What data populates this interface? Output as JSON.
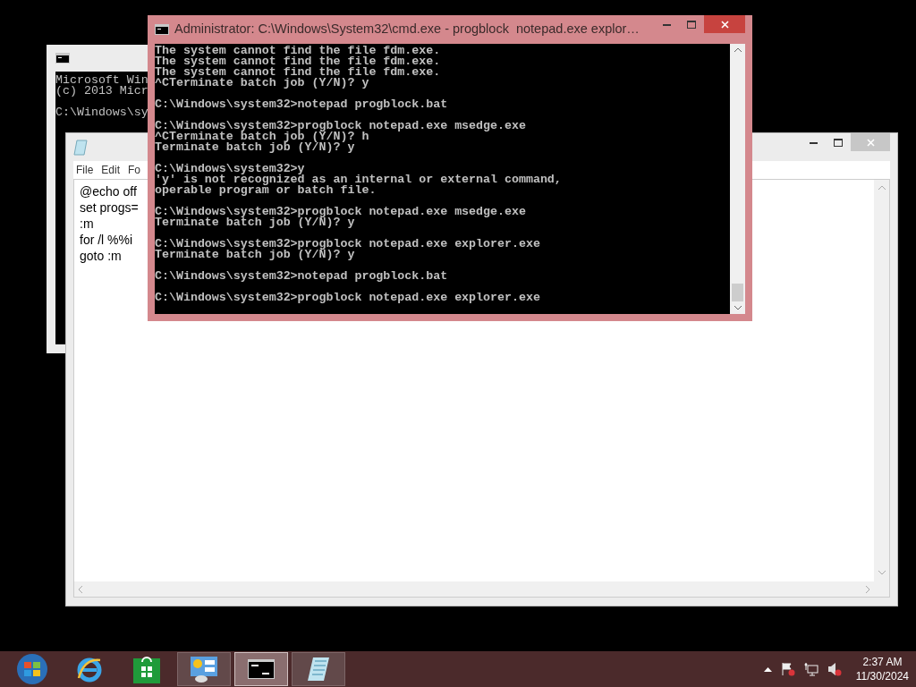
{
  "back_console": {
    "groups": [
      [
        "Microsoft Win",
        "(c) 2013 Micr"
      ],
      [
        "C:\\Windows\\sy"
      ]
    ]
  },
  "notepad": {
    "menu": [
      {
        "label": "File"
      },
      {
        "label": "Edit"
      },
      {
        "label": "Fo"
      }
    ],
    "lines": [
      "@echo off",
      "set progs=",
      ":m",
      "for /l %%i",
      "goto :m"
    ]
  },
  "console": {
    "title": "Administrator: C:\\Windows\\System32\\cmd.exe - progblock  notepad.exe explor…",
    "groups": [
      [
        "The system cannot find the file fdm.exe.",
        "The system cannot find the file fdm.exe.",
        "The system cannot find the file fdm.exe.",
        "^CTerminate batch job (Y/N)? y"
      ],
      [
        "C:\\Windows\\system32>notepad progblock.bat"
      ],
      [
        "C:\\Windows\\system32>progblock notepad.exe msedge.exe",
        "^CTerminate batch job (Y/N)? h",
        "Terminate batch job (Y/N)? y"
      ],
      [
        "C:\\Windows\\system32>y",
        "'y' is not recognized as an internal or external command,",
        "operable program or batch file."
      ],
      [
        "C:\\Windows\\system32>progblock notepad.exe msedge.exe",
        "Terminate batch job (Y/N)? y"
      ],
      [
        "C:\\Windows\\system32>progblock notepad.exe explorer.exe",
        "Terminate batch job (Y/N)? y"
      ],
      [
        "C:\\Windows\\system32>notepad progblock.bat"
      ],
      [
        "C:\\Windows\\system32>progblock notepad.exe explorer.exe"
      ]
    ]
  },
  "taskbar": {
    "items": [
      {
        "kind": "start",
        "running": false,
        "selected": false
      },
      {
        "kind": "browser",
        "running": false,
        "selected": false
      },
      {
        "kind": "store",
        "running": false,
        "selected": false
      },
      {
        "kind": "control",
        "running": true,
        "selected": false
      },
      {
        "kind": "console",
        "running": true,
        "selected": true
      },
      {
        "kind": "notepad",
        "running": true,
        "selected": false
      }
    ],
    "clock": {
      "time": "2:37 AM",
      "date": "11/30/2024"
    }
  }
}
